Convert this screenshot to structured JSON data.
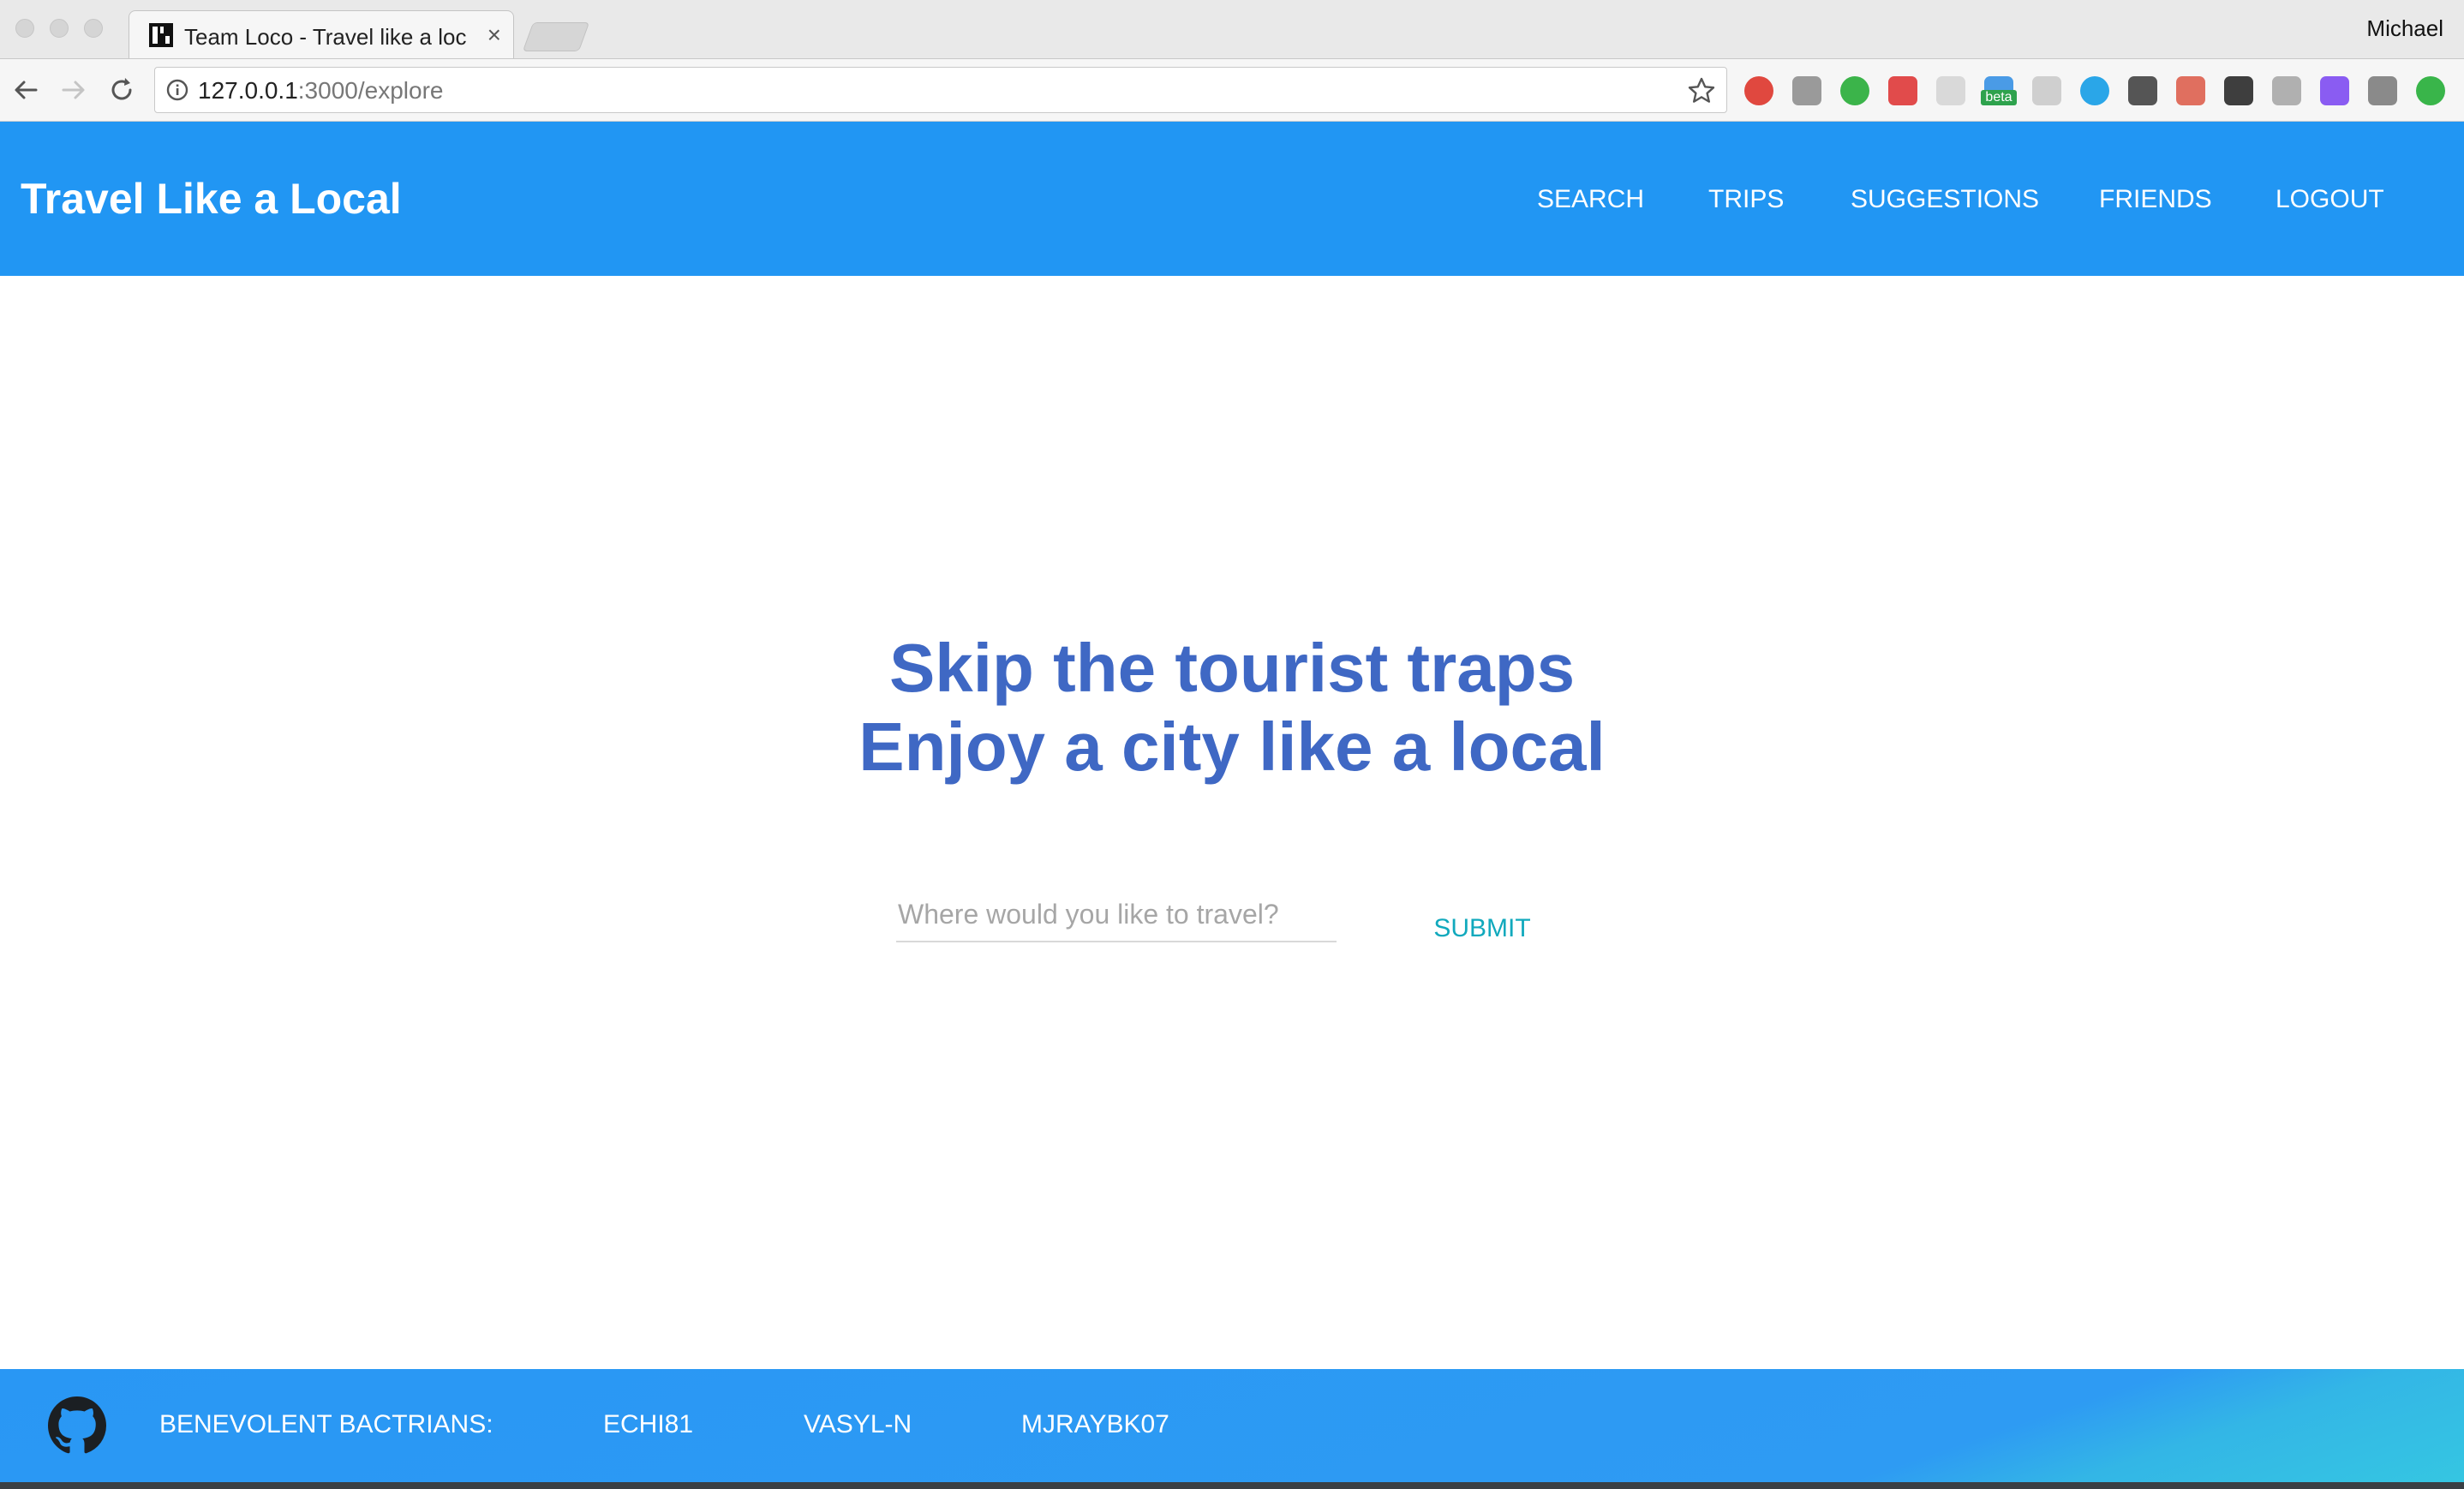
{
  "browser": {
    "tab_title": "Team Loco - Travel like a local",
    "tab_close": "×",
    "profile_name": "Michael",
    "url_host": "127.0.0.1",
    "url_path": ":3000/explore",
    "extensions": [
      {
        "name": "adblock-plus-icon",
        "color": "#e0483f"
      },
      {
        "name": "waveform-icon",
        "color": "#9a9a9a"
      },
      {
        "name": "hangouts-icon",
        "color": "#3bb44a"
      },
      {
        "name": "forward-media-icon",
        "color": "#e14b4b"
      },
      {
        "name": "reader-icon",
        "color": "#d9d9d9"
      },
      {
        "name": "beta-extension-icon",
        "color": "#2ea24d"
      },
      {
        "name": "screen-capture-icon",
        "color": "#cfcfcf"
      },
      {
        "name": "skype-icon",
        "color": "#2aa6e8"
      },
      {
        "name": "lightbulb-icon",
        "color": "#555555"
      },
      {
        "name": "photo-extension-icon",
        "color": "#e06f5f"
      },
      {
        "name": "cat-extension-icon",
        "color": "#3e3e3e"
      },
      {
        "name": "origami-icon",
        "color": "#b0b0b0"
      },
      {
        "name": "triangle-extension-icon",
        "color": "#8a5cf2"
      },
      {
        "name": "bowtie-extension-icon",
        "color": "#8a8a8a"
      },
      {
        "name": "update-arrow-icon",
        "color": "#39b54a"
      }
    ],
    "beta_badge": "beta"
  },
  "header": {
    "brand": "Travel Like a Local",
    "nav": [
      "SEARCH",
      "TRIPS",
      "SUGGESTIONS",
      "FRIENDS",
      "LOGOUT"
    ]
  },
  "hero": {
    "line1": "Skip the tourist traps",
    "line2": "Enjoy a city like a local",
    "search_placeholder": "Where would you like to travel?",
    "search_value": "",
    "submit_label": "SUBMIT"
  },
  "footer": {
    "team_label": "BENEVOLENT BACTRIANS:",
    "members": [
      "ECHI81",
      "VASYL-N",
      "MJRAYBK07"
    ]
  },
  "colors": {
    "primary": "#2196f3",
    "headline": "#3f68c4",
    "submit": "#11a9bd"
  }
}
